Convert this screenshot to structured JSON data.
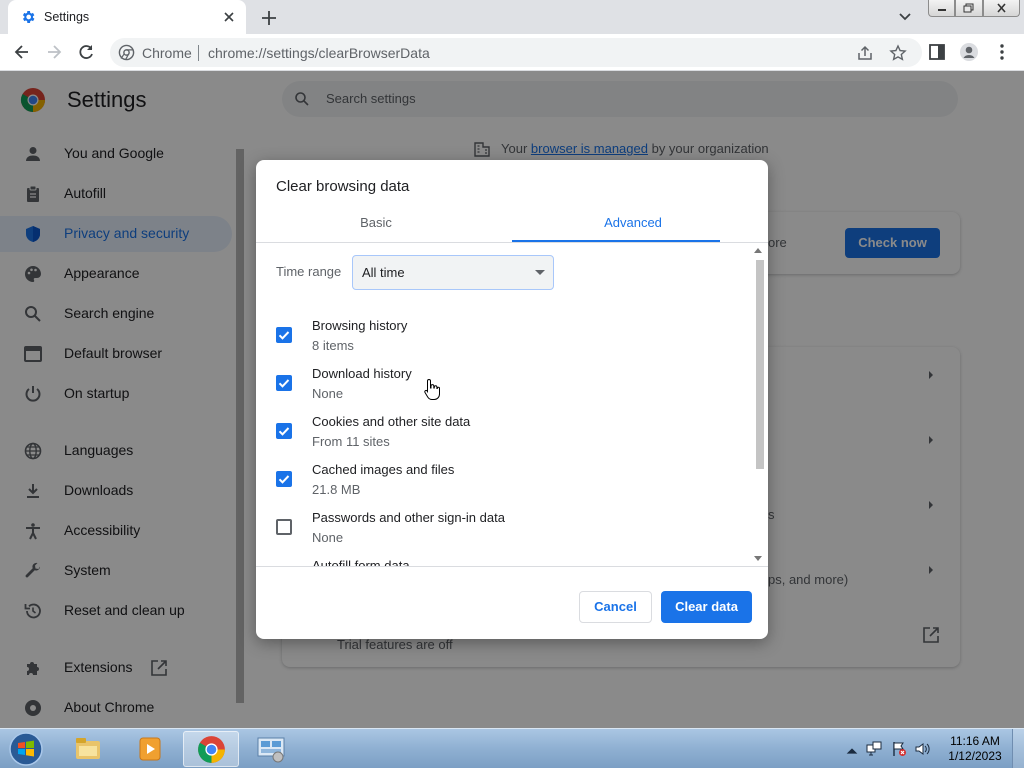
{
  "browser": {
    "tab_title": "Settings",
    "site_label": "Chrome",
    "url": "chrome://settings/clearBrowserData"
  },
  "settings": {
    "title": "Settings",
    "search_placeholder": "Search settings",
    "sidebar": [
      {
        "label": "You and Google",
        "icon": "person-icon"
      },
      {
        "label": "Autofill",
        "icon": "clipboard-icon"
      },
      {
        "label": "Privacy and security",
        "icon": "shield-icon",
        "active": true
      },
      {
        "label": "Appearance",
        "icon": "palette-icon"
      },
      {
        "label": "Search engine",
        "icon": "search-icon"
      },
      {
        "label": "Default browser",
        "icon": "browser-icon"
      },
      {
        "label": "On startup",
        "icon": "power-icon"
      },
      {
        "label": "Languages",
        "icon": "globe-icon"
      },
      {
        "label": "Downloads",
        "icon": "download-icon"
      },
      {
        "label": "Accessibility",
        "icon": "accessibility-icon"
      },
      {
        "label": "System",
        "icon": "wrench-icon"
      },
      {
        "label": "Reset and clean up",
        "icon": "restore-icon"
      },
      {
        "label": "Extensions",
        "icon": "puzzle-icon"
      },
      {
        "label": "About Chrome",
        "icon": "chrome-icon"
      }
    ],
    "managed_prefix": "Your",
    "managed_link": "browser is managed",
    "managed_suffix": "by your organization",
    "check_now": "Check now",
    "peek_text_1": "ore",
    "peek_text_2": "s",
    "peek_text_3": "ps, and more)",
    "trial_text": "Trial features are off"
  },
  "dialog": {
    "title": "Clear browsing data",
    "tabs": {
      "basic": "Basic",
      "advanced": "Advanced"
    },
    "active_tab": "Advanced",
    "time_range_label": "Time range",
    "time_range_value": "All time",
    "options": [
      {
        "title": "Browsing history",
        "sub": "8 items",
        "checked": true
      },
      {
        "title": "Download history",
        "sub": "None",
        "checked": true
      },
      {
        "title": "Cookies and other site data",
        "sub": "From 11 sites",
        "checked": true
      },
      {
        "title": "Cached images and files",
        "sub": "21.8 MB",
        "checked": true
      },
      {
        "title": "Passwords and other sign-in data",
        "sub": "None",
        "checked": false
      },
      {
        "title": "Autofill form data",
        "sub": "",
        "checked": false
      }
    ],
    "cancel": "Cancel",
    "clear": "Clear data"
  },
  "taskbar": {
    "time": "11:16 AM",
    "date": "1/12/2023"
  },
  "colors": {
    "accent": "#1a73e8",
    "text": "#202124",
    "secondary_text": "#5f6368"
  }
}
